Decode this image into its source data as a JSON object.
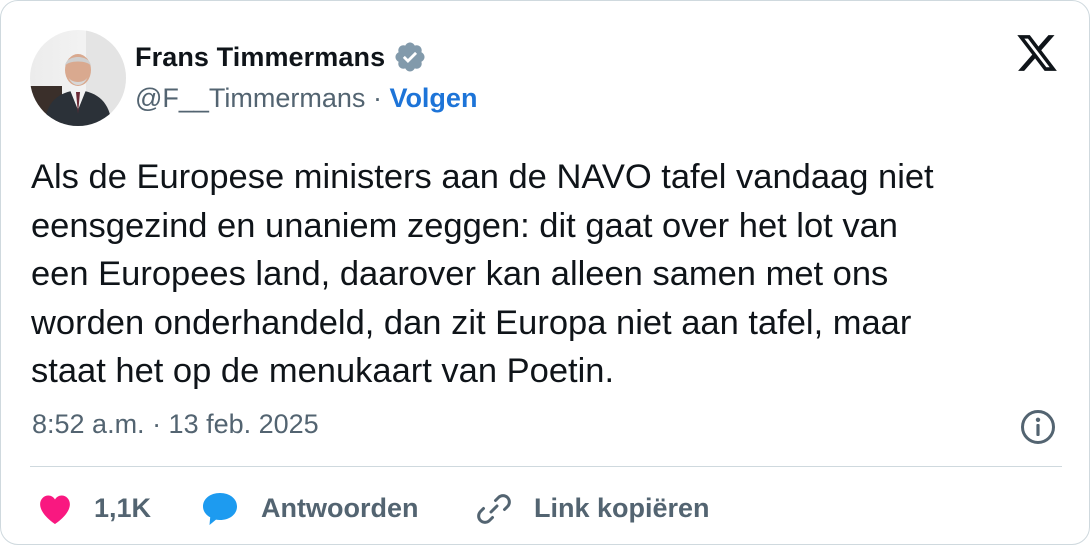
{
  "author": {
    "display_name": "Frans Timmermans",
    "handle": "@F__Timmermans",
    "separator": " · ",
    "follow_label": "Volgen"
  },
  "icons": {
    "avatar": "profile-photo",
    "verified": "verified-badge-icon",
    "brand": "x-logo-icon",
    "info": "info-icon",
    "like": "heart-icon",
    "reply": "speech-bubble-icon",
    "copy": "link-icon"
  },
  "tweet": {
    "lines": [
      "Als de Europese ministers aan de NAVO tafel vandaag niet",
      "eensgezind en unaniem zeggen: dit gaat over het lot van",
      "een Europees land, daarover kan alleen samen met ons",
      "worden onderhandeld, dan zit Europa niet aan tafel, maar",
      "staat het op de menukaart van Poetin."
    ],
    "timestamp": "8:52 a.m. · 13 feb. 2025"
  },
  "actions": {
    "like_count": "1,1K",
    "reply_label": "Antwoorden",
    "copy_label": "Link kopiëren"
  },
  "colors": {
    "text": "#0f1419",
    "secondary": "#536471",
    "follow_link": "#1d74d8",
    "like": "#f91880",
    "reply": "#1d9bf0",
    "verified_badge": "#829aab",
    "border": "#cfd9de"
  }
}
